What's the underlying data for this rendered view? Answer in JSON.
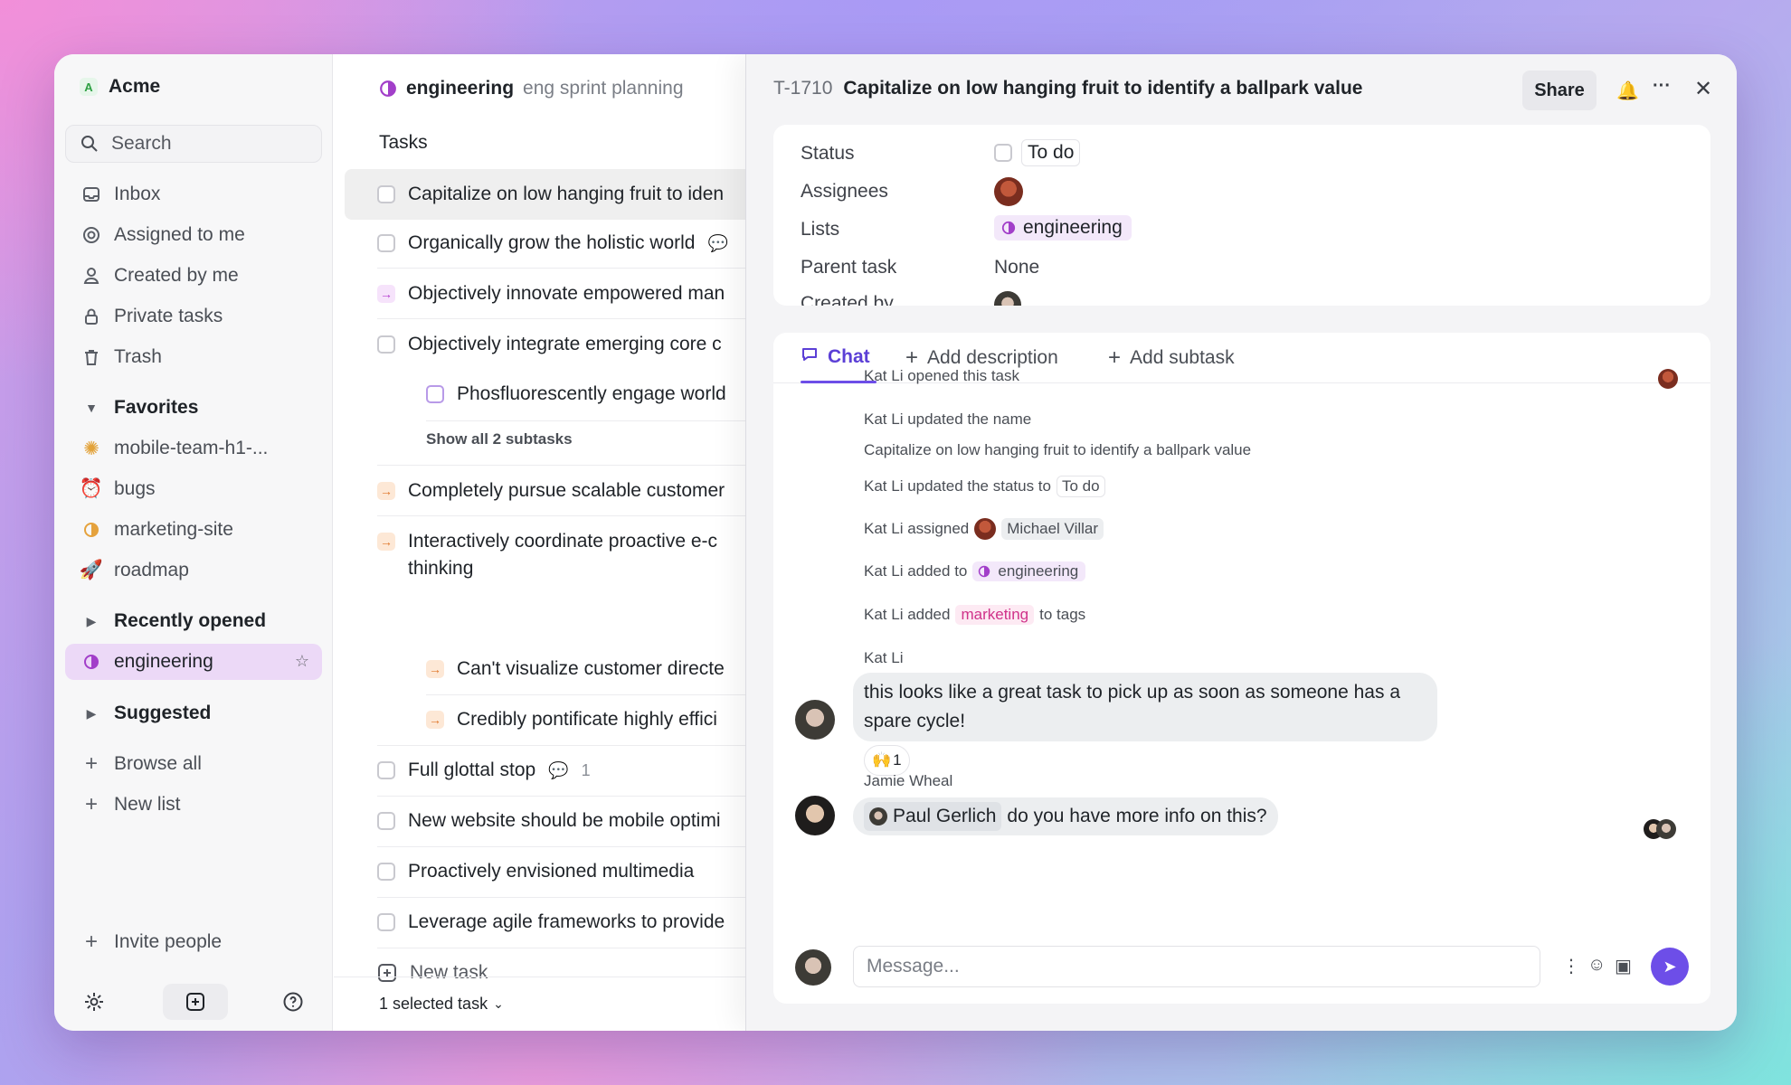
{
  "workspace": {
    "initial": "A",
    "name": "Acme"
  },
  "sidebar": {
    "search": "Search",
    "nav": [
      "Inbox",
      "Assigned to me",
      "Created by me",
      "Private tasks",
      "Trash"
    ],
    "favorites_label": "Favorites",
    "favorites": [
      "mobile-team-h1-...",
      "bugs",
      "marketing-site",
      "roadmap"
    ],
    "recent_label": "Recently opened",
    "recent": [
      "engineering"
    ],
    "suggested_label": "Suggested",
    "browse_all": "Browse all",
    "new_list": "New list",
    "invite": "Invite people"
  },
  "list": {
    "name": "engineering",
    "subtitle": "eng sprint planning",
    "tasks_label": "Tasks",
    "tasks": [
      "Capitalize on low hanging fruit to iden",
      "Organically grow the holistic world",
      "Objectively innovate empowered man",
      "Objectively integrate emerging core c",
      "Phosfluorescently engage world",
      "Show all 2 subtasks",
      "Completely pursue scalable customer",
      "Interactively coordinate proactive e-c",
      "thinking",
      "Can't visualize customer directe",
      "Credibly pontificate highly effici",
      "Full glottal stop",
      "New website should be mobile optimi",
      "Proactively envisioned multimedia",
      "Leverage agile frameworks to provide"
    ],
    "comment_count": "1",
    "new_task": "New task",
    "selected": "1 selected task"
  },
  "detail": {
    "id": "T-1710",
    "title": "Capitalize on low hanging fruit to identify a ballpark value",
    "share": "Share",
    "props": {
      "status_label": "Status",
      "status_value": "To do",
      "assignees_label": "Assignees",
      "lists_label": "Lists",
      "lists_value": "engineering",
      "parent_label": "Parent task",
      "parent_value": "None",
      "created_label": "Created by"
    },
    "tabs": {
      "chat": "Chat",
      "add_description": "Add description",
      "add_subtask": "Add subtask"
    },
    "activity": {
      "opened": "Kat Li opened this task",
      "updated_name": "Kat Li updated the name",
      "new_name": "Capitalize on low hanging fruit to identify a ballpark value",
      "updated_status": "Kat Li updated the status to",
      "status_chip": "To do",
      "assigned": "Kat Li assigned",
      "assignee": "Michael Villar",
      "added_to": "Kat Li added to",
      "list_chip": "engineering",
      "added_tag": "Kat Li added",
      "tag": "marketing",
      "to_tags": "to tags"
    },
    "messages": [
      {
        "author": "Kat Li",
        "text": "this looks like a great task to pick up as soon as someone has a spare cycle!",
        "reaction": "🙌",
        "reaction_count": "1"
      },
      {
        "author": "Jamie Wheal",
        "mention": "Paul Gerlich",
        "text": "do you have more info on this?"
      }
    ],
    "composer_placeholder": "Message..."
  },
  "colors": {
    "accent": "#6d4ee8",
    "active_bg": "#ecd9f7",
    "tag_pink": "#d0328a"
  }
}
